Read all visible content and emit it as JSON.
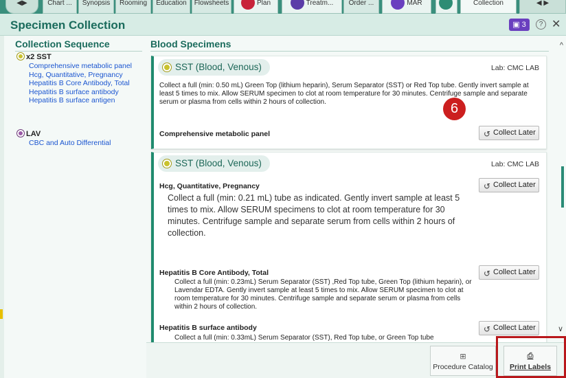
{
  "tabs": [
    {
      "label": "Chart ..."
    },
    {
      "label": "Synopsis"
    },
    {
      "label": "Rooming"
    },
    {
      "label": "Education"
    },
    {
      "label": "Flowsheets"
    },
    {
      "label": "Plan"
    },
    {
      "label": "Treatm..."
    },
    {
      "label": "Order ..."
    },
    {
      "label": "MAR"
    },
    {
      "label": "Collection"
    }
  ],
  "header": {
    "title": "Specimen Collection",
    "badge": "3"
  },
  "left": {
    "section_title": "Collection Sequence",
    "groups": [
      {
        "label": "x2 SST",
        "color": "#c9c22d",
        "items": [
          "Comprehensive metabolic panel",
          "Hcg, Quantitative, Pregnancy",
          "Hepatitis B Core Antibody, Total",
          "Hepatitis B surface antibody",
          "Hepatitis B surface antigen"
        ]
      },
      {
        "label": "LAV",
        "color": "#9a5aa6",
        "items": [
          "CBC and Auto Differential"
        ]
      }
    ]
  },
  "right": {
    "section_title": "Blood Specimens",
    "cards": [
      {
        "title": "SST (Blood, Venous)",
        "lab": "Lab: CMC LAB",
        "instructions": "Collect a full (min: 0.50 mL) Green Top (lithium heparin), Serum Separator (SST) or Red Top tube.  Gently invert sample at least 5 times to mix. Allow SERUM specimen to clot at room temperature for 30 minutes. Centrifuge sample and separate serum or plasma from cells within 2 hours of collection.",
        "test": "Comprehensive metabolic panel",
        "button": "Collect Later",
        "annotation": "6"
      },
      {
        "title": "SST (Blood, Venous)",
        "lab": "Lab: CMC LAB",
        "tests": [
          {
            "name": "Hcg, Quantitative, Pregnancy",
            "text": "Collect a full (min: 0.21 mL) tube as indicated. Gently invert sample at least 5 times to mix. Allow SERUM specimens to clot at room temperature for 30 minutes. Centrifuge sample and separate serum from cells within 2 hours of collection.",
            "button": "Collect Later"
          },
          {
            "name": "Hepatitis B Core Antibody, Total",
            "text": "Collect a full (min: 0.23mL) Serum Separator (SST) ,Red Top tube, Green Top (lithium heparin), or Lavendar EDTA. Gently invert sample at least 5 times to mix. Allow SERUM specimen to clot at room temperature for 30 minutes. Centrifuge sample and separate serum or plasma from cells within 2 hours of collection.",
            "button": "Collect Later"
          },
          {
            "name": "Hepatitis B surface antibody",
            "text": "Collect a full (min: 0.33mL) Serum Separator (SST), Red Top tube, or Green Top tube",
            "button": "Collect Later"
          }
        ]
      }
    ]
  },
  "footer": {
    "procedure_catalog": "Procedure Catalog",
    "print_labels": "Print Labels"
  }
}
